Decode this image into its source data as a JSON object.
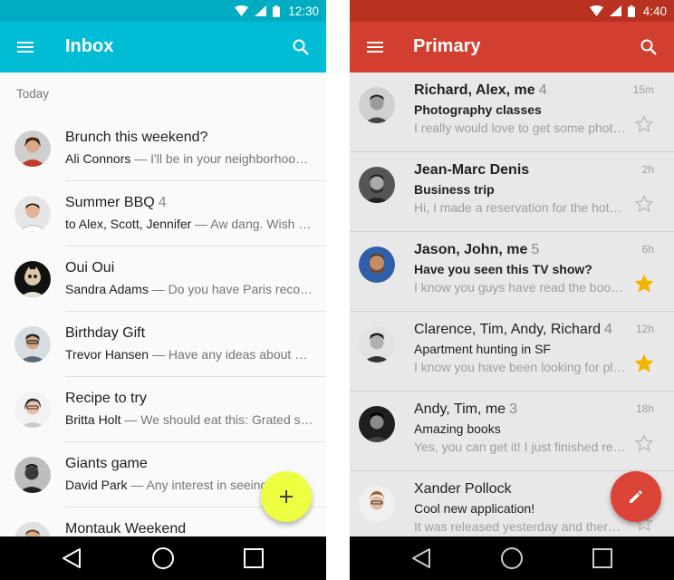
{
  "left": {
    "status": {
      "time": "12:30"
    },
    "appbar": {
      "title": "Inbox"
    },
    "section_header": "Today",
    "items": [
      {
        "title": "Brunch this weekend?",
        "count": "",
        "sender": "Ali Connors",
        "snippet": " — I'll be in your neighborhood doing errands this weekend"
      },
      {
        "title": "Summer BBQ",
        "count": "4",
        "sender": "to Alex, Scott, Jennifer",
        "snippet": " — Aw dang. Wish I could make it"
      },
      {
        "title": "Oui Oui",
        "count": "",
        "sender": "Sandra Adams",
        "snippet": " — Do you have Paris recommendations?"
      },
      {
        "title": "Birthday Gift",
        "count": "",
        "sender": "Trevor Hansen",
        "snippet": " — Have any ideas about what we should get"
      },
      {
        "title": "Recipe to try",
        "count": "",
        "sender": "Britta Holt",
        "snippet": " — We should eat this: Grated squash"
      },
      {
        "title": "Giants game",
        "count": "",
        "sender": "David Park",
        "snippet": " — Any interest in seeing the game"
      },
      {
        "title": "Montauk Weekend",
        "count": "",
        "sender": "",
        "snippet": ""
      }
    ],
    "fab_label": "+"
  },
  "right": {
    "status": {
      "time": "4:40"
    },
    "appbar": {
      "title": "Primary"
    },
    "messages": [
      {
        "senders": "Richard, Alex, me",
        "count": "4",
        "subject": "Photography classes",
        "snippet": "I really would love to get some photography tips",
        "time": "15m",
        "starred": false
      },
      {
        "senders": "Jean-Marc Denis",
        "count": "",
        "subject": "Business trip",
        "snippet": "Hi, I made a reservation for the hotel you talked about",
        "time": "2h",
        "starred": false
      },
      {
        "senders": "Jason, John, me",
        "count": "5",
        "subject": "Have you seen this TV show?",
        "snippet": "I know you guys have read the books but have you",
        "time": "6h",
        "starred": true
      },
      {
        "senders": "Clarence, Tim, Andy, Richard",
        "count": "4",
        "subject": "Apartment hunting in SF",
        "snippet": "I know you have been looking for places to live",
        "time": "12h",
        "starred": true
      },
      {
        "senders": "Andy, Tim, me",
        "count": "3",
        "subject": "Amazing books",
        "snippet": "Yes, you can get it! I just finished reading it",
        "time": "18h",
        "starred": false
      },
      {
        "senders": "Xander Pollock",
        "count": "",
        "subject": "Cool new application!",
        "snippet": "It was released yesterday and there's a lot",
        "time": "",
        "starred": false
      }
    ]
  },
  "colors": {
    "inbox_appbar": "#00bcd4",
    "inbox_statusbar": "#00acc1",
    "gmail_appbar": "#d23f31",
    "gmail_statusbar": "#b93221",
    "fab_yellow": "#eeff41",
    "fab_red": "#db4437",
    "star_on": "#f4b400"
  },
  "icons": {
    "menu": "menu-icon",
    "search": "search-icon",
    "add": "add-icon",
    "edit": "pencil-icon",
    "star": "star-icon",
    "back": "back-icon",
    "home": "home-icon",
    "recents": "recents-icon"
  }
}
